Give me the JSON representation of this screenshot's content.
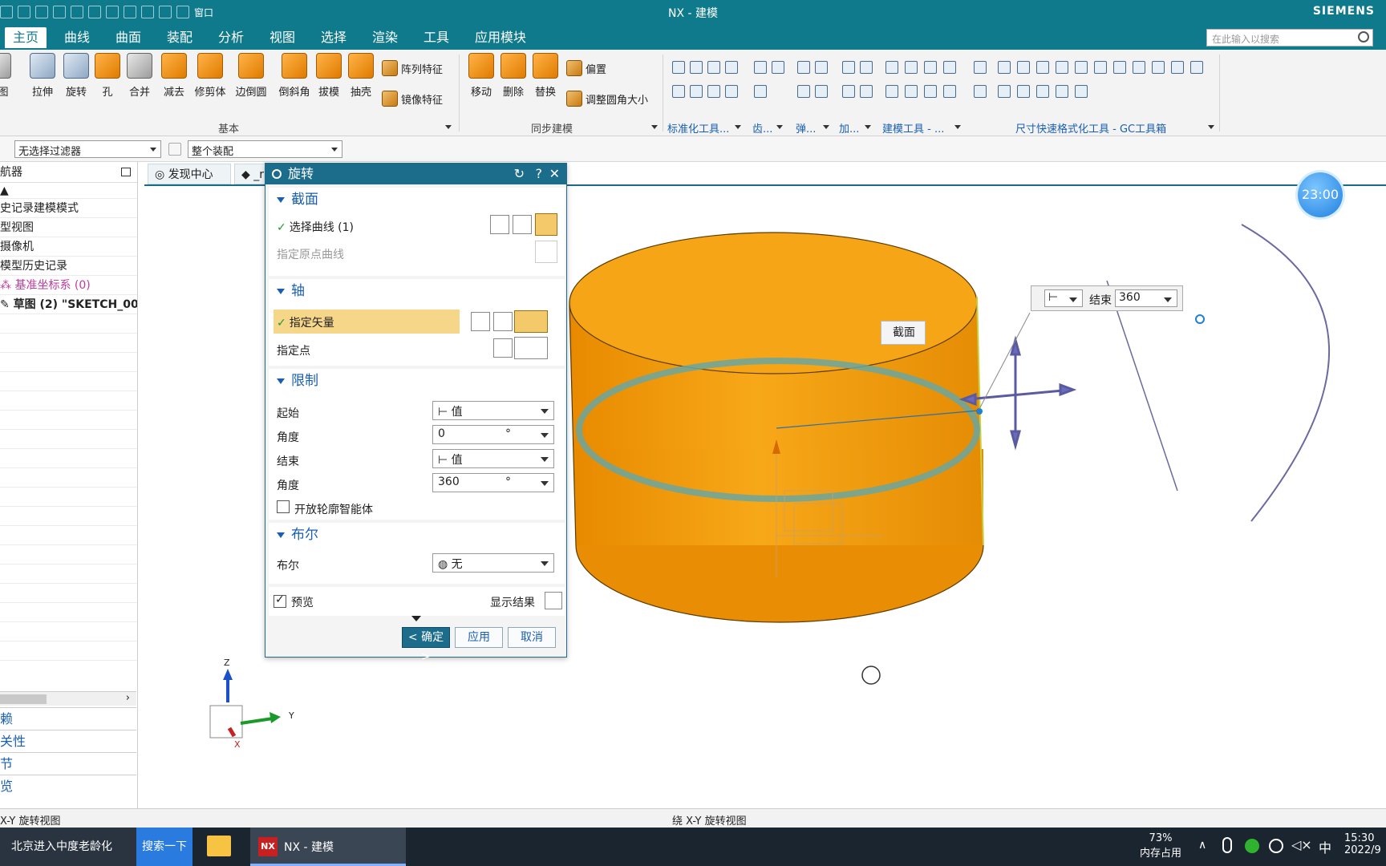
{
  "window": {
    "title": "NX - 建模",
    "brand": "SIEMENS",
    "quick_access_window": "窗口"
  },
  "menu": {
    "tabs": [
      "主页",
      "曲线",
      "曲面",
      "装配",
      "分析",
      "视图",
      "选择",
      "渲染",
      "工具",
      "应用模块"
    ],
    "active": "主页",
    "search_placeholder": "在此输入以搜索"
  },
  "ribbon": {
    "feature_buttons": [
      {
        "label": "图",
        "icon": "sketch-icon"
      },
      {
        "label": "拉伸",
        "icon": "extrude-icon"
      },
      {
        "label": "旋转",
        "icon": "revolve-icon"
      },
      {
        "label": "孔",
        "icon": "hole-icon"
      },
      {
        "label": "合并",
        "icon": "unite-icon"
      },
      {
        "label": "减去",
        "icon": "subtract-icon"
      },
      {
        "label": "修剪体",
        "icon": "trim-body-icon"
      },
      {
        "label": "边倒圆",
        "icon": "edge-blend-icon"
      },
      {
        "label": "倒斜角",
        "icon": "chamfer-icon"
      },
      {
        "label": "拔模",
        "icon": "draft-icon"
      },
      {
        "label": "抽壳",
        "icon": "shell-icon"
      }
    ],
    "pattern_feature": "阵列特征",
    "mirror_feature": "镜像特征",
    "sync_buttons": [
      {
        "label": "移动",
        "icon": "move-face-icon"
      },
      {
        "label": "删除",
        "icon": "delete-face-icon"
      },
      {
        "label": "替换",
        "icon": "replace-face-icon"
      }
    ],
    "offset": "偏置",
    "resize_blend": "调整圆角大小",
    "groups": {
      "basic": "基本",
      "sync": "同步建模",
      "standard_tools": "标准化工具...",
      "gear": "齿...",
      "spring": "弹...",
      "add": "加...",
      "modeling_tools": "建模工具 - ...",
      "dim_format": "尺寸快速格式化工具 - GC工具箱"
    }
  },
  "filterbar": {
    "type_filter": "无选择过滤器",
    "scope": "整个装配"
  },
  "navigator": {
    "title": "航器",
    "rows": [
      {
        "text": "史记录建模模式",
        "style": ""
      },
      {
        "text": "型视图",
        "style": ""
      },
      {
        "text": "摄像机",
        "style": ""
      },
      {
        "text": "模型历史记录",
        "style": ""
      },
      {
        "text": "基准坐标系 (0)",
        "style": "pink"
      },
      {
        "text": "草图 (2) \"SKETCH_00",
        "style": "bold"
      }
    ],
    "bottom_items": [
      "赖",
      "关性",
      "节",
      "览"
    ]
  },
  "doc_tabs": {
    "discovery": "发现中心",
    "part": "_r"
  },
  "dialog": {
    "title": "旋转",
    "section": {
      "title": "截面",
      "select_curve": "选择曲线 (1)",
      "specify_origin_curve": "指定原点曲线"
    },
    "axis": {
      "title": "轴",
      "specify_vector": "指定矢量",
      "specify_point": "指定点"
    },
    "limits": {
      "title": "限制",
      "start_label": "起始",
      "start_value": "值",
      "angle1_label": "角度",
      "angle1_value": "0",
      "end_label": "结束",
      "end_value": "值",
      "angle2_label": "角度",
      "angle2_value": "360",
      "unit": "°",
      "open_profile": "开放轮廓智能体"
    },
    "boolean": {
      "title": "布尔",
      "label": "布尔",
      "value": "无"
    },
    "preview": "预览",
    "show_result": "显示结果",
    "ok": "< 确定 >",
    "apply": "应用",
    "cancel": "取消"
  },
  "viewport": {
    "float_end_label": "结束",
    "float_end_value": "360",
    "section_tag": "截面",
    "clock": "23:00",
    "triad_x": "X",
    "triad_y": "Y",
    "triad_z": "Z"
  },
  "status": {
    "left": "X-Y 旋转视图",
    "center": "绕 X-Y 旋转视图"
  },
  "taskbar": {
    "news": "北京进入中度老龄化",
    "search": "搜索一下",
    "app": "NX - 建模",
    "memory_pct": "73%",
    "memory_label": "内存占用",
    "ime": "中",
    "time": "15:30",
    "date": "2022/9"
  },
  "colors": {
    "brand_teal": "#0f7a8c",
    "dialog_blue": "#1c6c8c",
    "body_orange": "#f39c1a",
    "highlight_yellow": "#f6d78a"
  }
}
